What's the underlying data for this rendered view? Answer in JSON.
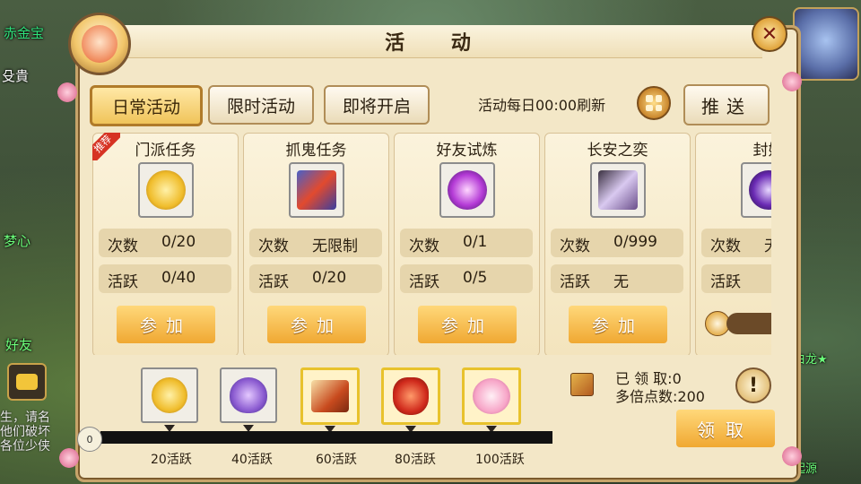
{
  "background": {
    "top_left_name": "赤金宝",
    "left_texts": [
      "殳貴",
      "梦心",
      "好友"
    ],
    "chat_lines": [
      "生，请名",
      "他们破坏",
      "各位少侠"
    ],
    "right_texts": [
      "小白龙★",
      "池起源"
    ]
  },
  "panel": {
    "title": "活 动",
    "close_symbol": "✕"
  },
  "tabs": {
    "daily": "日常活动",
    "limited": "限时活动",
    "upcoming": "即将开启"
  },
  "header": {
    "refresh_text": "活动每日00:00刷新",
    "push_label": "推送"
  },
  "cards": [
    {
      "title": "门派任务",
      "badge": "推荐",
      "count_label": "次数",
      "count": "0/20",
      "active_label": "活跃",
      "active": "0/40",
      "button": "参加",
      "icon": "coin-icon"
    },
    {
      "title": "抓鬼任务",
      "count_label": "次数",
      "count": "无限制",
      "active_label": "活跃",
      "active": "0/20",
      "button": "参加",
      "icon": "ghost-card-icon"
    },
    {
      "title": "好友试炼",
      "count_label": "次数",
      "count": "0/1",
      "active_label": "活跃",
      "active": "0/5",
      "button": "参加",
      "icon": "purple-orb-icon"
    },
    {
      "title": "长安之奕",
      "count_label": "次数",
      "count": "0/999",
      "active_label": "活跃",
      "active": "无",
      "button": "参加",
      "icon": "chess-spirit-icon"
    },
    {
      "title": "封妖",
      "count_label": "次数",
      "count": "无",
      "active_label": "活跃",
      "active": "",
      "icon": "seal-icon"
    }
  ],
  "rewards": {
    "start_value": "0",
    "milestones": [
      "20活跃",
      "40活跃",
      "60活跃",
      "80活跃",
      "100活跃"
    ],
    "icons": [
      "coin-icon",
      "purple-pouch-icon",
      "scroll-icon",
      "red-bag-icon",
      "pig-icon"
    ],
    "claimed_text": "已 领 取:0",
    "multiplier_text": "多倍点数:200",
    "claim_label": "领取",
    "info_symbol": "!"
  },
  "colors": {
    "panel_bg": "#f3e7c7",
    "button_gold": "#f0a832",
    "badge_red": "#d63323"
  }
}
